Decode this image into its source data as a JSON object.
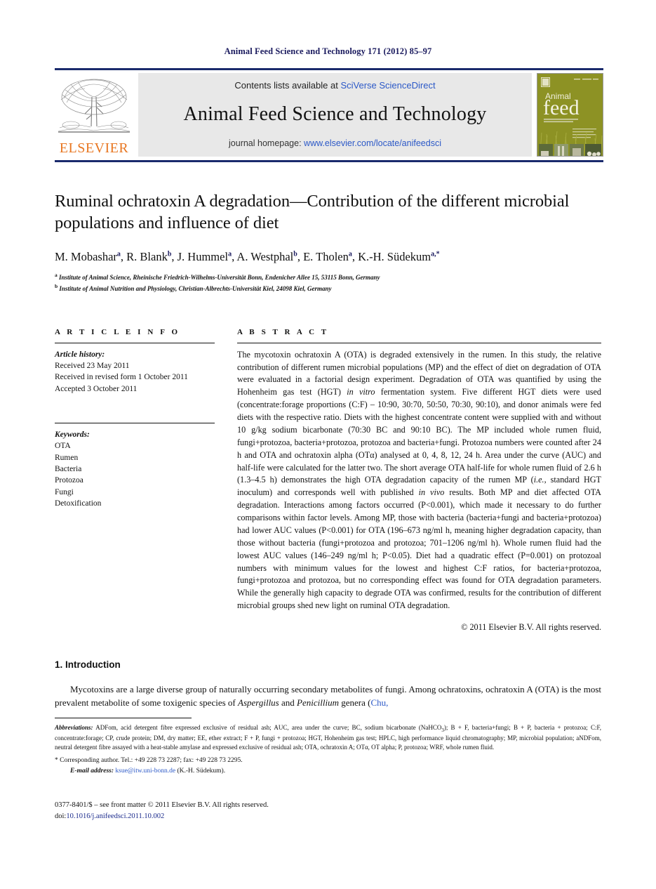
{
  "running_head": "Animal Feed Science and Technology 171 (2012) 85–97",
  "masthead": {
    "publisher_name": "ELSEVIER",
    "contents_prefix": "Contents lists available at ",
    "contents_link": "SciVerse ScienceDirect",
    "journal_title": "Animal Feed Science and Technology",
    "homepage_prefix": "journal homepage: ",
    "homepage_link": "www.elsevier.com/locate/anifeedsci",
    "cover_line1": "Animal",
    "cover_line2": "feed",
    "cover_line3": "SCIENCE AND TECHNOLOGY"
  },
  "article": {
    "title": "Ruminal ochratoxin A degradation—Contribution of the different microbial populations and influence of diet",
    "authors_html": "M. Mobashar<sup>a</sup>, R. Blank<sup>b</sup>, J. Hummel<sup>a</sup>, A. Westphal<sup>b</sup>, E. Tholen<sup>a</sup>, K.-H. Südekum<sup>a,*</sup>",
    "affiliations": [
      {
        "marker": "a",
        "text": "Institute of Animal Science, Rheinische Friedrich-Wilhelms-Universität Bonn, Endenicher Allee 15, 53115 Bonn, Germany"
      },
      {
        "marker": "b",
        "text": "Institute of Animal Nutrition and Physiology, Christian-Albrechts-Universität Kiel, 24098 Kiel, Germany"
      }
    ]
  },
  "article_info": {
    "heading": "A R T I C L E    I N F O",
    "history_label": "Article history:",
    "history": [
      "Received 23 May 2011",
      "Received in revised form 1 October 2011",
      "Accepted 3 October 2011"
    ],
    "keywords_label": "Keywords:",
    "keywords": [
      "OTA",
      "Rumen",
      "Bacteria",
      "Protozoa",
      "Fungi",
      "Detoxification"
    ]
  },
  "abstract": {
    "heading": "A B S T R A C T",
    "paragraph_html": "The mycotoxin ochratoxin A (OTA) is degraded extensively in the rumen. In this study, the relative contribution of different rumen microbial populations (MP) and the effect of diet on degradation of OTA were evaluated in a factorial design experiment. Degradation of OTA was quantified by using the Hohenheim gas test (HGT) <i>in vitro</i> fermentation system. Five different HGT diets were used (concentrate:forage proportions (C:F) – 10:90, 30:70, 50:50, 70:30, 90:10), and donor animals were fed diets with the respective ratio. Diets with the highest concentrate content were supplied with and without 10 g/kg sodium bicarbonate (70:30 BC and 90:10 BC). The MP included whole rumen fluid, fungi+protozoa, bacteria+protozoa, protozoa and bacteria+fungi. Protozoa numbers were counted after 24 h and OTA and ochratoxin alpha (OTα) analysed at 0, 4, 8, 12, 24 h. Area under the curve (AUC) and half-life were calculated for the latter two. The short average OTA half-life for whole rumen fluid of 2.6 h (1.3–4.5 h) demonstrates the high OTA degradation capacity of the rumen MP (<i>i.e.</i>, standard HGT inoculum) and corresponds well with published <i>in vivo</i> results. Both MP and diet affected OTA degradation. Interactions among factors occurred (P&lt;0.001), which made it necessary to do further comparisons within factor levels. Among MP, those with bacteria (bacteria+fungi and bacteria+protozoa) had lower AUC values (P&lt;0.001) for OTA (196–673 ng/ml h, meaning higher degradation capacity, than those without bacteria (fungi+protozoa and protozoa; 701–1206 ng/ml h). Whole rumen fluid had the lowest AUC values (146–249 ng/ml h; P&lt;0.05). Diet had a quadratic effect (P=0.001) on protozoal numbers with minimum values for the lowest and highest C:F ratios, for bacteria+protozoa, fungi+protozoa and protozoa, but no corresponding effect was found for OTA degradation parameters. While the generally high capacity to degrade OTA was confirmed, results for the contribution of different microbial groups shed new light on ruminal OTA degradation.",
    "copyright": "© 2011 Elsevier B.V. All rights reserved."
  },
  "introduction": {
    "heading": "1.  Introduction",
    "paragraph_html": "Mycotoxins are a large diverse group of naturally occurring secondary metabolites of fungi. Among ochratoxins, ochratoxin A (OTA) is the most prevalent metabolite of some toxigenic species of <i>Aspergillus</i> and <i>Penicillium</i> genera (<a href=\"#\">Chu,</a>"
  },
  "footnotes": {
    "abbreviations_label": "Abbreviations:",
    "abbreviations_html": " ADFom, acid detergent fibre expressed exclusive of residual ash; AUC, area under the curve; BC, sodium bicarbonate (NaHCO<sub>3</sub>); B + F, bacteria+fungi; B + P, bacteria + protozoa; C:F, concentrate:forage; CP, crude protein; DM, dry matter; EE, ether extract; F + P, fungi + protozoa; HGT, Hohenheim gas test; HPLC, high performance liquid chromatography; MP, microbial population; aNDFom, neutral detergent fibre assayed with a heat-stable amylase and expressed exclusive of residual ash; OTA, ochratoxin A; OTα, OT alpha; P, protozoa; WRF, whole rumen fluid.",
    "corresponding": "*  Corresponding author. Tel.: +49 228 73 2287; fax: +49 228 73 2295.",
    "email_label": "E-mail address:",
    "email": "ksue@itw.uni-bonn.de",
    "email_suffix": " (K.-H. Südekum)."
  },
  "bottom_matter": {
    "issn_line": "0377-8401/$ – see front matter © 2011 Elsevier B.V. All rights reserved.",
    "doi_label": "doi:",
    "doi": "10.1016/j.anifeedsci.2011.10.002"
  },
  "colors": {
    "rule_blue": "#1a2a6c",
    "link_blue": "#2b58c7",
    "elsevier_orange": "#E87722",
    "cover_olive": "#8d9224"
  }
}
